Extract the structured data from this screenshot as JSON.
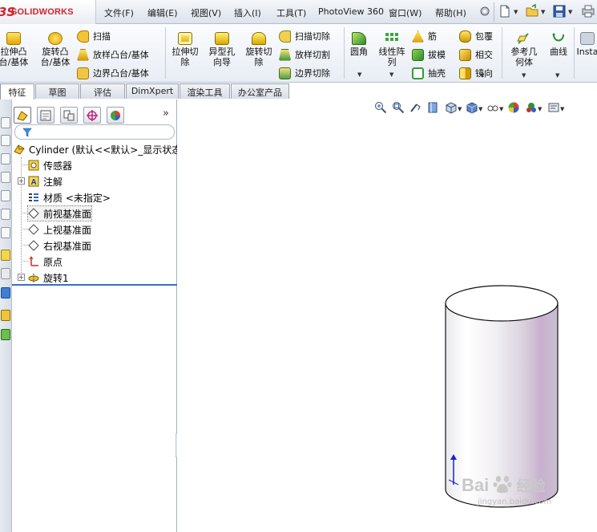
{
  "app": {
    "logo_ds": "3S",
    "logo_text": "SOLIDWORKS"
  },
  "menu": {
    "items": [
      "文件(F)",
      "编辑(E)",
      "视图(V)",
      "插入(I)",
      "工具(T)",
      "PhotoView 360",
      "窗口(W)",
      "帮助(H)"
    ]
  },
  "ribbon": {
    "extrude_boss": "拉伸凸\n台/基体",
    "revolve_boss": "旋转凸\n台/基体",
    "sweep": "扫描",
    "loft_boss": "放样凸台/基体",
    "boundary_boss": "边界凸台/基体",
    "extrude_cut": "拉伸切\n除",
    "hole_wizard": "异型孔\n向导",
    "revolve_cut": "旋转切\n除",
    "swept_cut": "扫描切除",
    "lofted_cut": "放样切割",
    "boundary_cut": "边界切除",
    "fillet": "圆角",
    "linear_pattern": "线性阵\n列",
    "rib": "筋",
    "draft": "拔模",
    "shell": "抽壳",
    "wrap": "包覆",
    "intersect": "相交",
    "mirror": "镜向",
    "ref_geometry": "参考几\n何体",
    "curves": "曲线",
    "instant3d": "Insta"
  },
  "tabs": [
    "特征",
    "草图",
    "评估",
    "DimXpert",
    "渲染工具",
    "办公室产品"
  ],
  "active_tab": "特征",
  "feature_tree": {
    "part": "Cylinder  (默认<<默认>_显示状态",
    "items": [
      {
        "label": "传感器"
      },
      {
        "label": "注解"
      },
      {
        "label": "材质 <未指定>"
      },
      {
        "label": "前视基准面"
      },
      {
        "label": "上视基准面"
      },
      {
        "label": "右视基准面"
      },
      {
        "label": "原点"
      },
      {
        "label": "旋转1"
      }
    ],
    "more": "»"
  },
  "watermark": {
    "brand": "Bai",
    "brand_cn": "经验",
    "url": "jingyan.baidu.com"
  },
  "colors": {
    "accent": "#3a6fc9",
    "logo": "#d2232a",
    "cylinder_tint": "#c9b0cf"
  }
}
